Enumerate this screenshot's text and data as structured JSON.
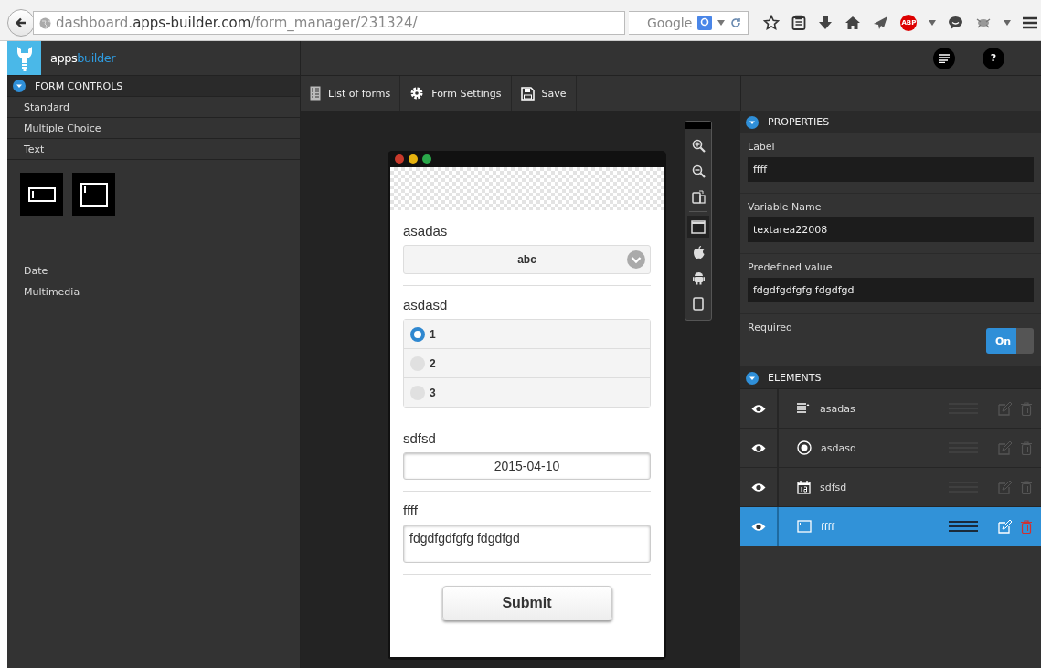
{
  "browser": {
    "url": "dashboard.**apps-builder.com**/form_manager/231324/",
    "search_engine": "Google",
    "adblock_badge": "ABP"
  },
  "app": {
    "logo": {
      "first": "apps",
      "second": "builder"
    },
    "help": "?"
  },
  "sidebar": {
    "title": "FORM CONTROLS",
    "expanded": true,
    "items": [
      {
        "label": "Standard",
        "expanded": false
      },
      {
        "label": "Multiple Choice",
        "expanded": false
      },
      {
        "label": "Text",
        "expanded": true,
        "tiles": [
          {
            "kind": "textfield"
          },
          {
            "kind": "textarea"
          }
        ]
      },
      {
        "label": "Date",
        "expanded": false
      },
      {
        "label": "Multimedia",
        "expanded": false
      }
    ]
  },
  "toolbar": [
    {
      "kind": "list",
      "label": "List of forms"
    },
    {
      "kind": "settings",
      "label": "Form Settings"
    },
    {
      "kind": "save",
      "label": "Save"
    }
  ],
  "preview_tools": [
    {
      "kind": "zoom-in",
      "selected": false
    },
    {
      "kind": "zoom-out",
      "selected": false
    },
    {
      "kind": "rotate",
      "selected": false
    },
    {
      "kind": "window",
      "selected": true
    },
    {
      "kind": "apple",
      "selected": false
    },
    {
      "kind": "robot",
      "selected": false
    },
    {
      "kind": "tablet",
      "selected": false
    }
  ],
  "form": {
    "fields": [
      {
        "kind": "select",
        "label": "asadas",
        "value": "abc"
      },
      {
        "kind": "radio",
        "label": "asdasd",
        "options": [
          {
            "label": "1",
            "selected": true
          },
          {
            "label": "2",
            "selected": false
          },
          {
            "label": "3",
            "selected": false
          }
        ]
      },
      {
        "kind": "date",
        "label": "sdfsd",
        "value": "2015-04-10"
      },
      {
        "kind": "textarea",
        "label": "ffff",
        "value": "fdgdfgdfgfg fdgdfgd"
      }
    ],
    "submit": "Submit"
  },
  "properties": {
    "title": "PROPERTIES",
    "expanded": true,
    "fields": [
      {
        "label": "Label",
        "value": "ffff"
      },
      {
        "label": "Variable Name",
        "value": "textarea22008"
      },
      {
        "label": "Predefined value",
        "value": "fdgdfgdfgfg fdgdfgd"
      }
    ],
    "required": {
      "label": "Required",
      "on": true,
      "state_text": "On"
    }
  },
  "elements": {
    "title": "ELEMENTS",
    "expanded": true,
    "items": [
      {
        "kind": "select",
        "label": "asadas",
        "visible": true,
        "selected": false
      },
      {
        "kind": "radio",
        "label": "asdasd",
        "visible": true,
        "selected": false
      },
      {
        "kind": "date",
        "label": "sdfsd",
        "visible": true,
        "selected": false
      },
      {
        "kind": "textarea",
        "label": "ffff",
        "visible": true,
        "selected": true
      }
    ]
  }
}
